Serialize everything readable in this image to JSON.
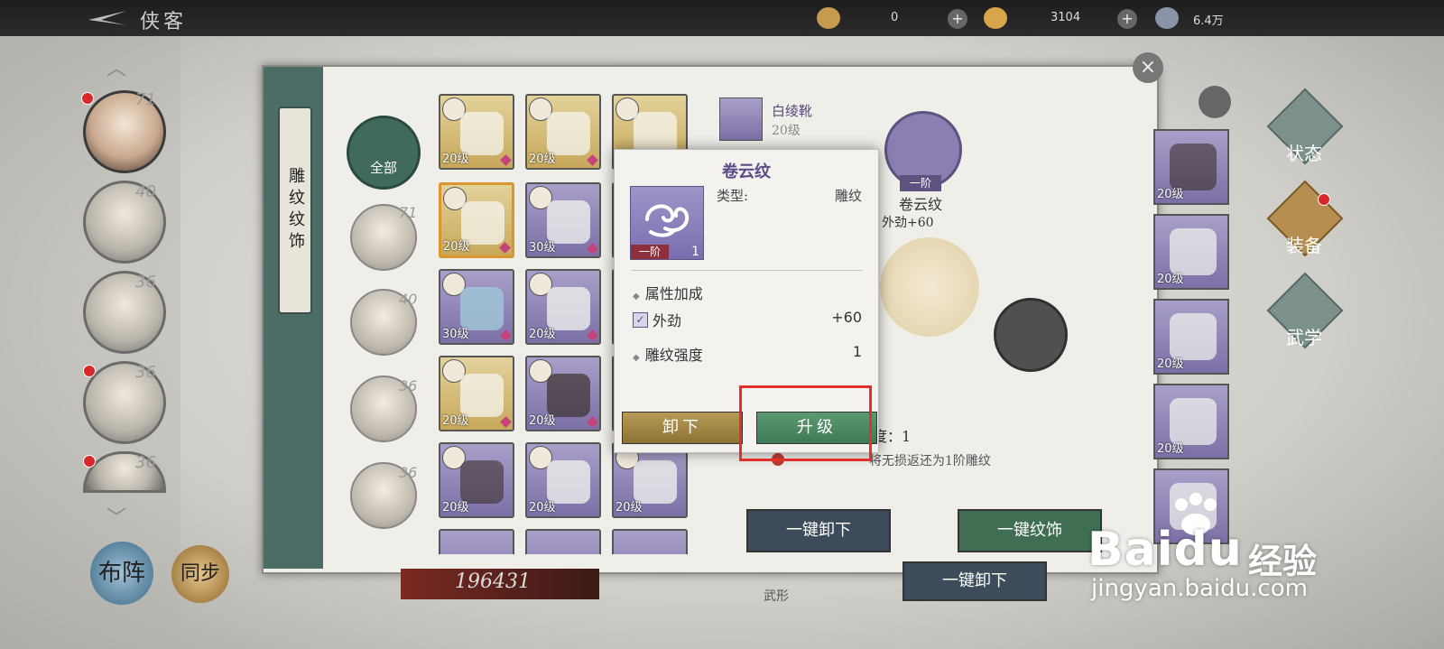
{
  "topbar": {
    "title": "侠客",
    "resources": [
      {
        "icon": "leaf-currency-icon",
        "value": "0"
      },
      {
        "icon": "gold-ingot-icon",
        "value": "3104"
      },
      {
        "icon": "coin-icon",
        "value": "6.4万"
      }
    ]
  },
  "roster": {
    "heroes": [
      {
        "level": "71",
        "active": true,
        "red_dot": true
      },
      {
        "level": "40",
        "active": false,
        "red_dot": false
      },
      {
        "level": "36",
        "active": false,
        "red_dot": false
      },
      {
        "level": "36",
        "active": false,
        "red_dot": true
      },
      {
        "level": "36",
        "active": false,
        "red_dot": true
      }
    ],
    "buttons": {
      "formation": "布阵",
      "sync": "同步"
    }
  },
  "right_nav": {
    "items": [
      {
        "label": "状态",
        "active": false
      },
      {
        "label": "装备",
        "active": true
      },
      {
        "label": "武学",
        "active": false
      }
    ]
  },
  "panel": {
    "side_tab": "雕纹纹饰",
    "filter_all": "全部",
    "filter_levels": [
      "71",
      "40",
      "36",
      "36"
    ],
    "grid": [
      {
        "level": "20级",
        "tier": "gold",
        "kind": "sword"
      },
      {
        "level": "20级",
        "tier": "gold",
        "kind": "robe"
      },
      {
        "level": "",
        "tier": "gold",
        "kind": "belt"
      },
      {
        "level": "20级",
        "tier": "gold",
        "kind": "boots",
        "selected": true
      },
      {
        "level": "30级",
        "tier": "purple",
        "kind": "sword"
      },
      {
        "level": "",
        "tier": "purple",
        "kind": "cloak"
      },
      {
        "level": "30级",
        "tier": "purple",
        "kind": "boots"
      },
      {
        "level": "20级",
        "tier": "purple",
        "kind": "robe"
      },
      {
        "level": "",
        "tier": "purple",
        "kind": "blank"
      },
      {
        "level": "20级",
        "tier": "gold",
        "kind": "boots"
      },
      {
        "level": "20级",
        "tier": "purple",
        "kind": "bracer"
      },
      {
        "level": "",
        "tier": "purple",
        "kind": "blank"
      },
      {
        "level": "20级",
        "tier": "purple",
        "kind": "staff"
      },
      {
        "level": "20级",
        "tier": "purple",
        "kind": "robe"
      },
      {
        "level": "20级",
        "tier": "purple",
        "kind": "belt"
      }
    ],
    "detail": {
      "item_name": "白绫靴",
      "item_level": "20级",
      "carve_tier": "一阶",
      "carve_name": "卷云纹",
      "carve_attr": "外劲+60",
      "strength_label": "强度：1",
      "note": "将无损返还为1阶雕纹",
      "btn_unload_all": "一键卸下",
      "btn_carve_all": "一键纹饰",
      "btn_unload_bottom": "一键卸下"
    },
    "right_items": [
      "20级",
      "20级",
      "20级",
      "20级",
      ""
    ]
  },
  "score": "196431",
  "bottom_label": "武形",
  "modal": {
    "title": "卷云纹",
    "type_label": "类型:",
    "type_value": "雕纹",
    "tier": "一阶",
    "count": "1",
    "section_attr": "属性加成",
    "attr_name": "外劲",
    "attr_value": "+60",
    "strength_label": "雕纹强度",
    "strength_value": "1",
    "btn_unload": "卸下",
    "btn_upgrade": "升级"
  },
  "watermark": {
    "brand": "Baidu",
    "sub": "经验",
    "url": "jingyan.baidu.com"
  },
  "colors": {
    "accent_purple": "#5c4a86",
    "upgrade_green": "#3f7a55",
    "highlight_red": "#e2312a"
  }
}
